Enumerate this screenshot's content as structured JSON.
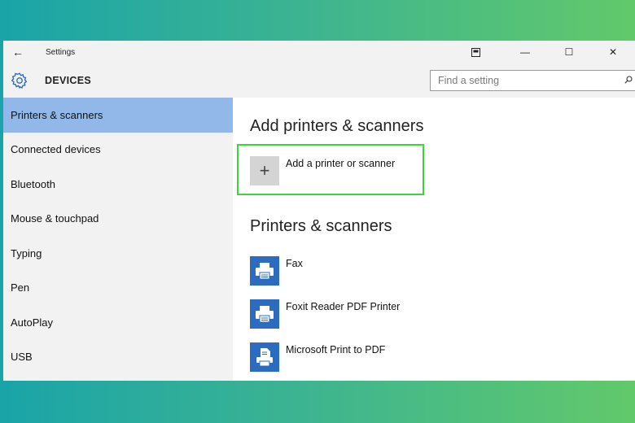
{
  "window": {
    "title": "Settings",
    "section": "DEVICES",
    "controls": {
      "tablet_icon": "tablet-mode-icon",
      "minimize": "—",
      "maximize": "☐",
      "close": "✕"
    }
  },
  "search": {
    "placeholder": "Find a setting",
    "icon": "search-icon"
  },
  "sidebar": {
    "items": [
      {
        "label": "Printers & scanners",
        "active": true
      },
      {
        "label": "Connected devices"
      },
      {
        "label": "Bluetooth"
      },
      {
        "label": "Mouse & touchpad"
      },
      {
        "label": "Typing"
      },
      {
        "label": "Pen"
      },
      {
        "label": "AutoPlay"
      },
      {
        "label": "USB"
      }
    ]
  },
  "main": {
    "add_heading": "Add printers & scanners",
    "add_button_label": "Add a printer or scanner",
    "list_heading": "Printers & scanners",
    "printers": [
      {
        "name": "Fax",
        "icon": "printer-icon"
      },
      {
        "name": "Foxit Reader PDF Printer",
        "icon": "printer-icon"
      },
      {
        "name": "Microsoft Print to PDF",
        "icon": "document-printer-icon"
      }
    ]
  },
  "colors": {
    "accent_selected": "#92b8e9",
    "highlight_border": "#3cd63a",
    "printer_tile": "#2b6cc0",
    "sidebar_bg": "#f2f2f2"
  }
}
